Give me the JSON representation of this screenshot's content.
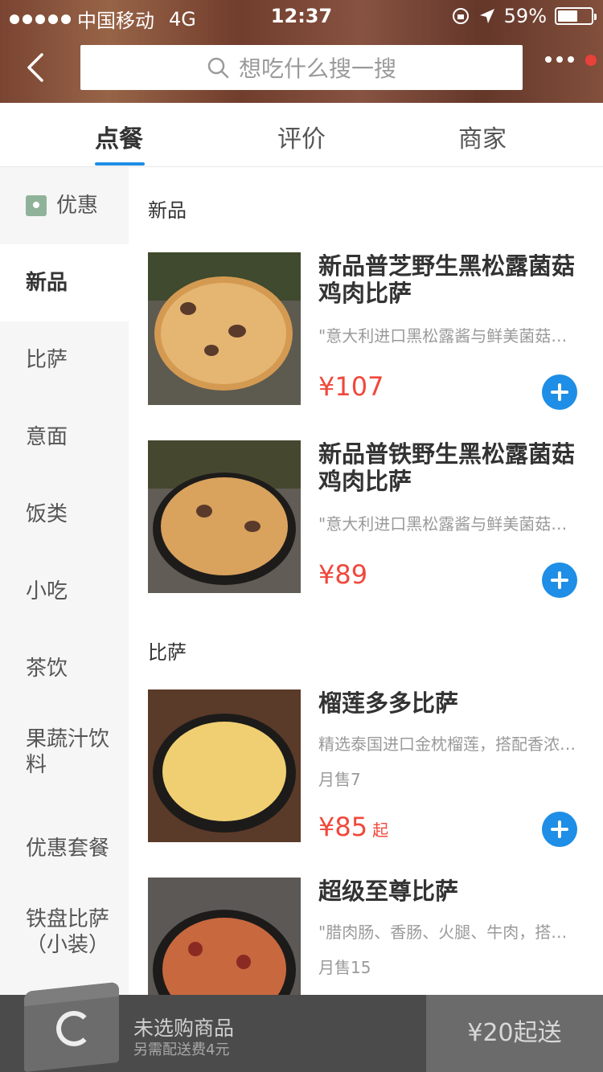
{
  "status_bar": {
    "carrier": "中国移动",
    "network": "4G",
    "time": "12:37",
    "battery": "59%",
    "battery_level": 0.59
  },
  "search": {
    "placeholder": "想吃什么搜一搜"
  },
  "tabs": [
    {
      "label": "点餐",
      "active": true
    },
    {
      "label": "评价",
      "active": false
    },
    {
      "label": "商家",
      "active": false
    }
  ],
  "sidebar": {
    "items": [
      {
        "label": "优惠"
      },
      {
        "label": "新品"
      },
      {
        "label": "比萨"
      },
      {
        "label": "意面"
      },
      {
        "label": "饭类"
      },
      {
        "label": "小吃"
      },
      {
        "label": "茶饮"
      },
      {
        "label": "果蔬汁饮料"
      },
      {
        "label": "优惠套餐"
      },
      {
        "label": "铁盘比萨（小装）"
      }
    ]
  },
  "sections": [
    {
      "title": "新品",
      "items": [
        {
          "name": "新品普芝野生黑松露菌菇鸡肉比萨",
          "desc": "\"意大利进口黑松露酱与鲜美菌菇…",
          "price": "¥107"
        },
        {
          "name": "新品普铁野生黑松露菌菇鸡肉比萨",
          "desc": "\"意大利进口黑松露酱与鲜美菌菇…",
          "price": "¥89"
        }
      ]
    },
    {
      "title": "比萨",
      "items": [
        {
          "name": "榴莲多多比萨",
          "desc": "精选泰国进口金枕榴莲，搭配香浓…",
          "sales": "月售7",
          "price": "¥85",
          "price_suffix": "起"
        },
        {
          "name": "超级至尊比萨",
          "desc": "\"腊肉肠、香肠、火腿、牛肉，搭…",
          "sales": "月售15"
        }
      ]
    }
  ],
  "cart": {
    "status": "未选购商品",
    "delivery_fee": "另需配送费4元",
    "min_order": "¥20起送"
  },
  "colors": {
    "accent": "#1e8ee6",
    "price": "#f0483c",
    "cart_bar": "#4b4b4b"
  }
}
